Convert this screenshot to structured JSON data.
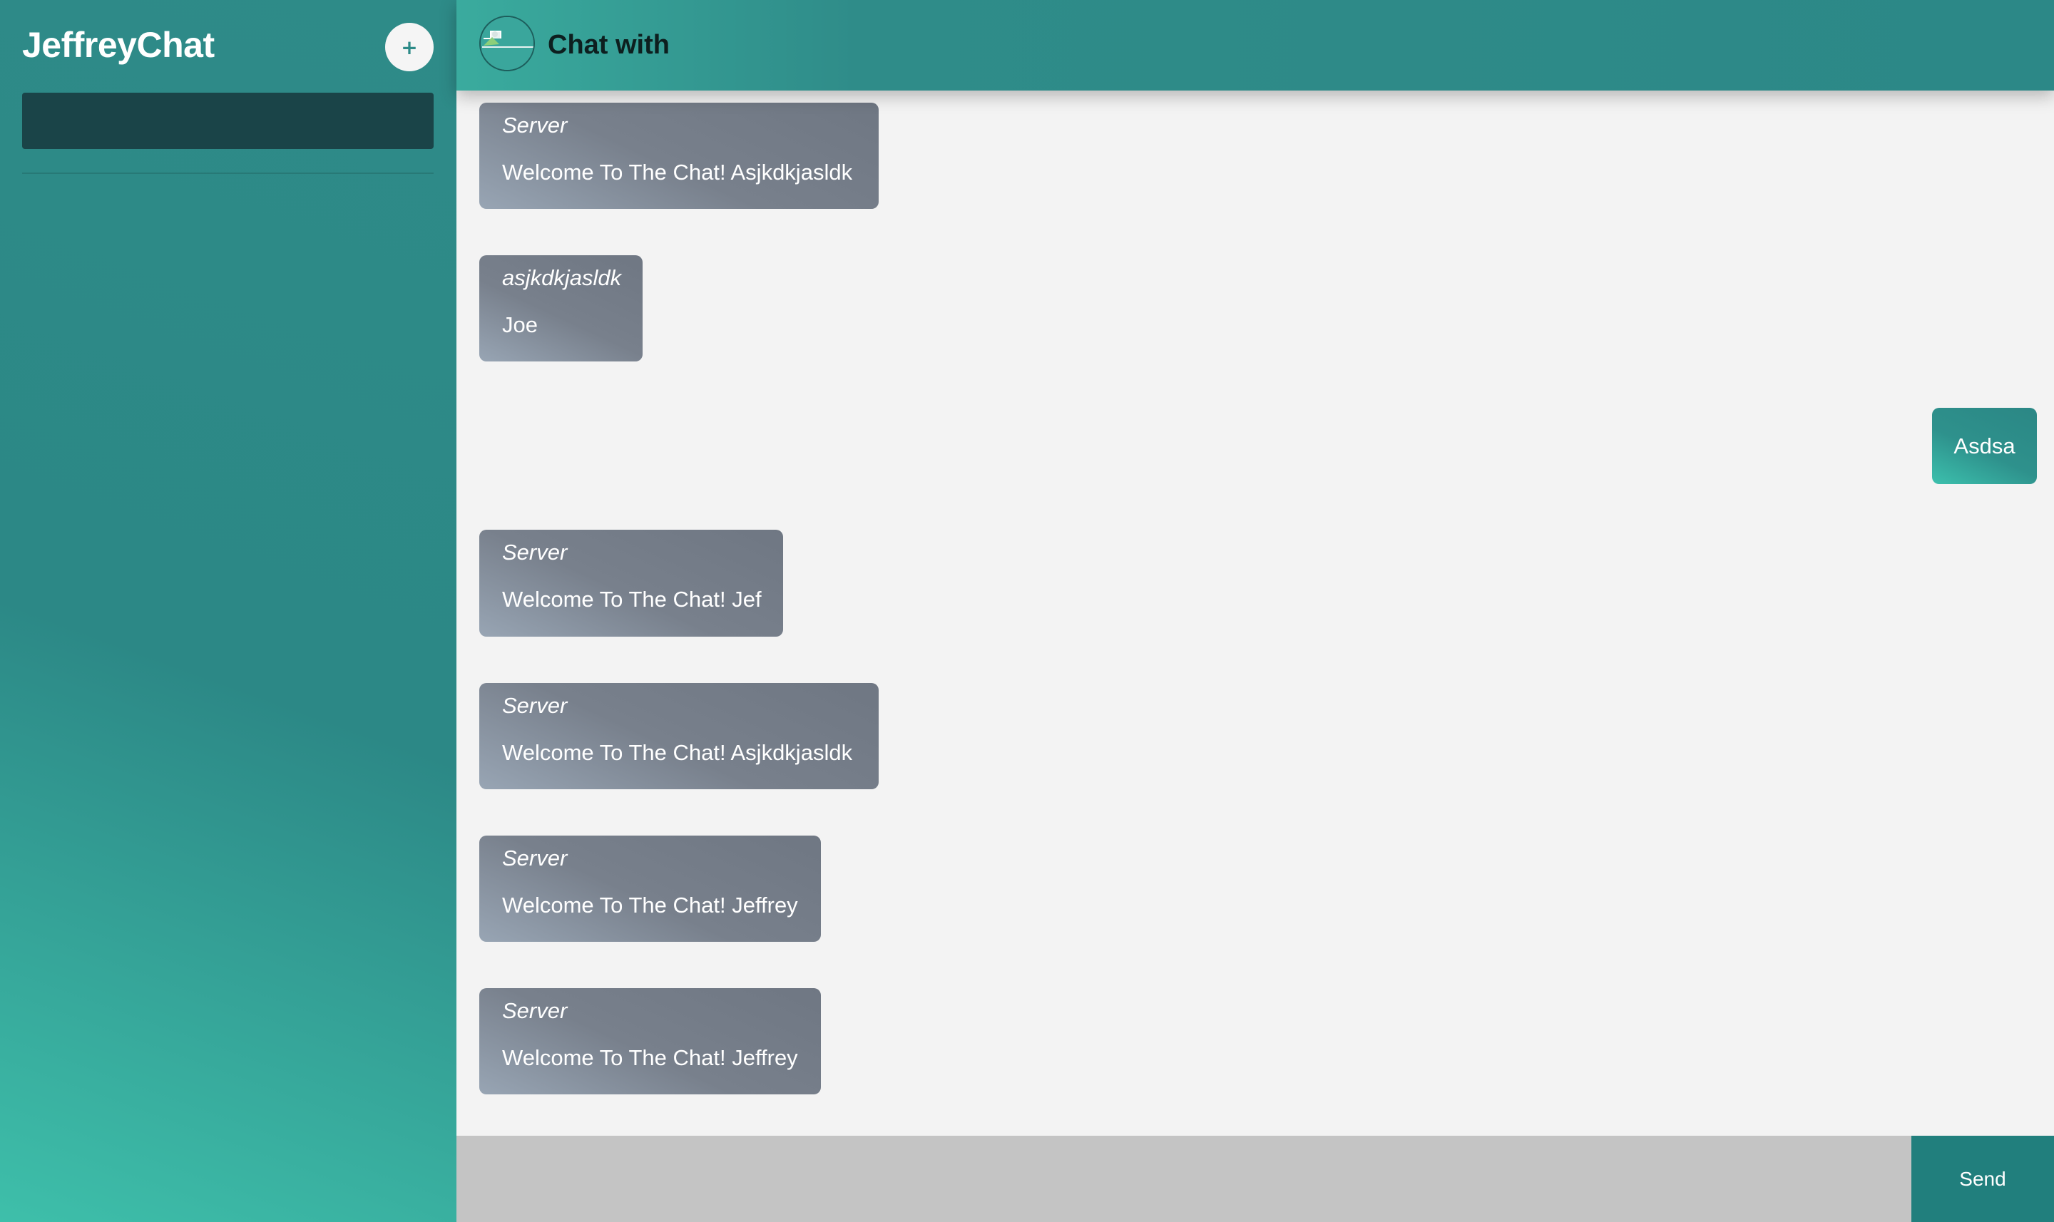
{
  "sidebar": {
    "brand": "JeffreyChat",
    "new_chat_label": "+",
    "search_value": "",
    "search_placeholder": ""
  },
  "header": {
    "avatar": "broken-image-icon",
    "title": "Chat with"
  },
  "messages": [
    {
      "sender": "Server",
      "text": "Welcome To The Chat! Asjkdkjasldk",
      "mine": false
    },
    {
      "sender": "asjkdkjasldk",
      "text": "Joe",
      "mine": false
    },
    {
      "sender": "",
      "text": "Asdsa",
      "mine": true
    },
    {
      "sender": "Server",
      "text": "Welcome To The Chat! Jef",
      "mine": false
    },
    {
      "sender": "Server",
      "text": "Welcome To The Chat! Asjkdkjasldk",
      "mine": false
    },
    {
      "sender": "Server",
      "text": "Welcome To The Chat! Jeffrey",
      "mine": false
    },
    {
      "sender": "Server",
      "text": "Welcome To The Chat! Jeffrey",
      "mine": false
    }
  ],
  "composer": {
    "input_value": "",
    "input_placeholder": "",
    "send_label": "Send"
  },
  "colors": {
    "sidebar": "#2e8b88",
    "accent": "#217f7d",
    "received_bubble": "#737b87",
    "sent_bubble": "#2e918c",
    "input_bg": "#c4c4c4"
  }
}
